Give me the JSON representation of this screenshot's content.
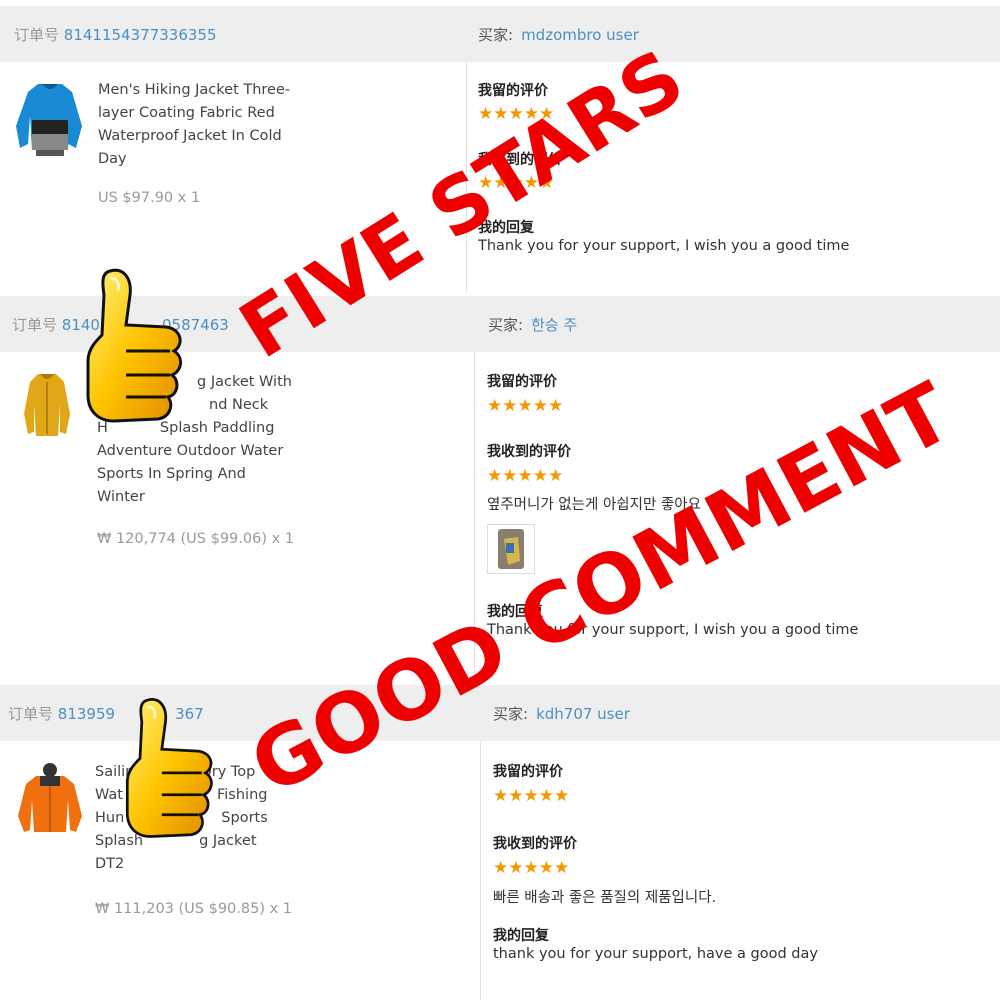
{
  "orders": [
    {
      "order_label": "订单号",
      "order_no": "8141154377336355",
      "buyer_label": "买家:",
      "buyer": "mdzombro user",
      "product_title": "Men's Hiking Jacket Three-layer Coating Fabric Red Waterproof Jacket In Cold Day",
      "price": "US $97.90 x 1",
      "my_review_label": "我留的评价",
      "my_review_stars": "★★★★★",
      "received_review_label": "我收到的评价",
      "received_review_stars": "★★★★★",
      "received_review_text": "",
      "my_reply_label": "我的回复",
      "my_reply": "Thank you for your support, I wish you a good time"
    },
    {
      "order_label": "订单号",
      "order_no": "8140",
      "order_no_tail": "0587463",
      "buyer_label": "买家:",
      "buyer": "한승 주",
      "product_title_l1": "g Jacket With",
      "product_title_l2": "nd Neck",
      "product_title_l3": "Splash Paddling",
      "product_title_l3_pre": "H",
      "product_title_l4": "Adventure Outdoor Water",
      "product_title_l5": "Sports In Spring And",
      "product_title_l6": "Winter",
      "price": "₩ 120,774 (US $99.06) x 1",
      "my_review_label": "我留的评价",
      "my_review_stars": "★★★★★",
      "received_review_label": "我收到的评价",
      "received_review_stars": "★★★★★",
      "received_review_text": "옆주머니가 없는게 아쉽지만 좋아요",
      "my_reply_label": "我的回复",
      "my_reply": "Thank you for your support, I wish you a good time"
    },
    {
      "order_label": "订单号",
      "order_no": "813959",
      "order_no_tail": "367",
      "buyer_label": "买家:",
      "buyer": "kdh707 user",
      "product_title_l1a": "Sailing",
      "product_title_l1b": "Dry Top",
      "product_title_l2a": "Wat",
      "product_title_l2b": "Fishing",
      "product_title_l3a": "Hun",
      "product_title_l3b": "Sports",
      "product_title_l4a": "Splash",
      "product_title_l4b": "g Jacket",
      "product_title_l5": "DT2",
      "price": "₩ 111,203 (US $90.85) x 1",
      "my_review_label": "我留的评价",
      "my_review_stars": "★★★★★",
      "received_review_label": "我收到的评价",
      "received_review_stars": "★★★★★",
      "received_review_text": "빠른 배송과 좋은 품질의 제품입니다.",
      "my_reply_label": "我的回复",
      "my_reply": "thank you for your support, have a good day"
    }
  ],
  "overlay": {
    "stamp_1": "FIVE STARS",
    "stamp_2": "GOOD COMMENT",
    "color": "#ee0000"
  },
  "colors": {
    "link": "#4a90c4",
    "star": "#f39800",
    "header_bg": "#eeeeee"
  }
}
